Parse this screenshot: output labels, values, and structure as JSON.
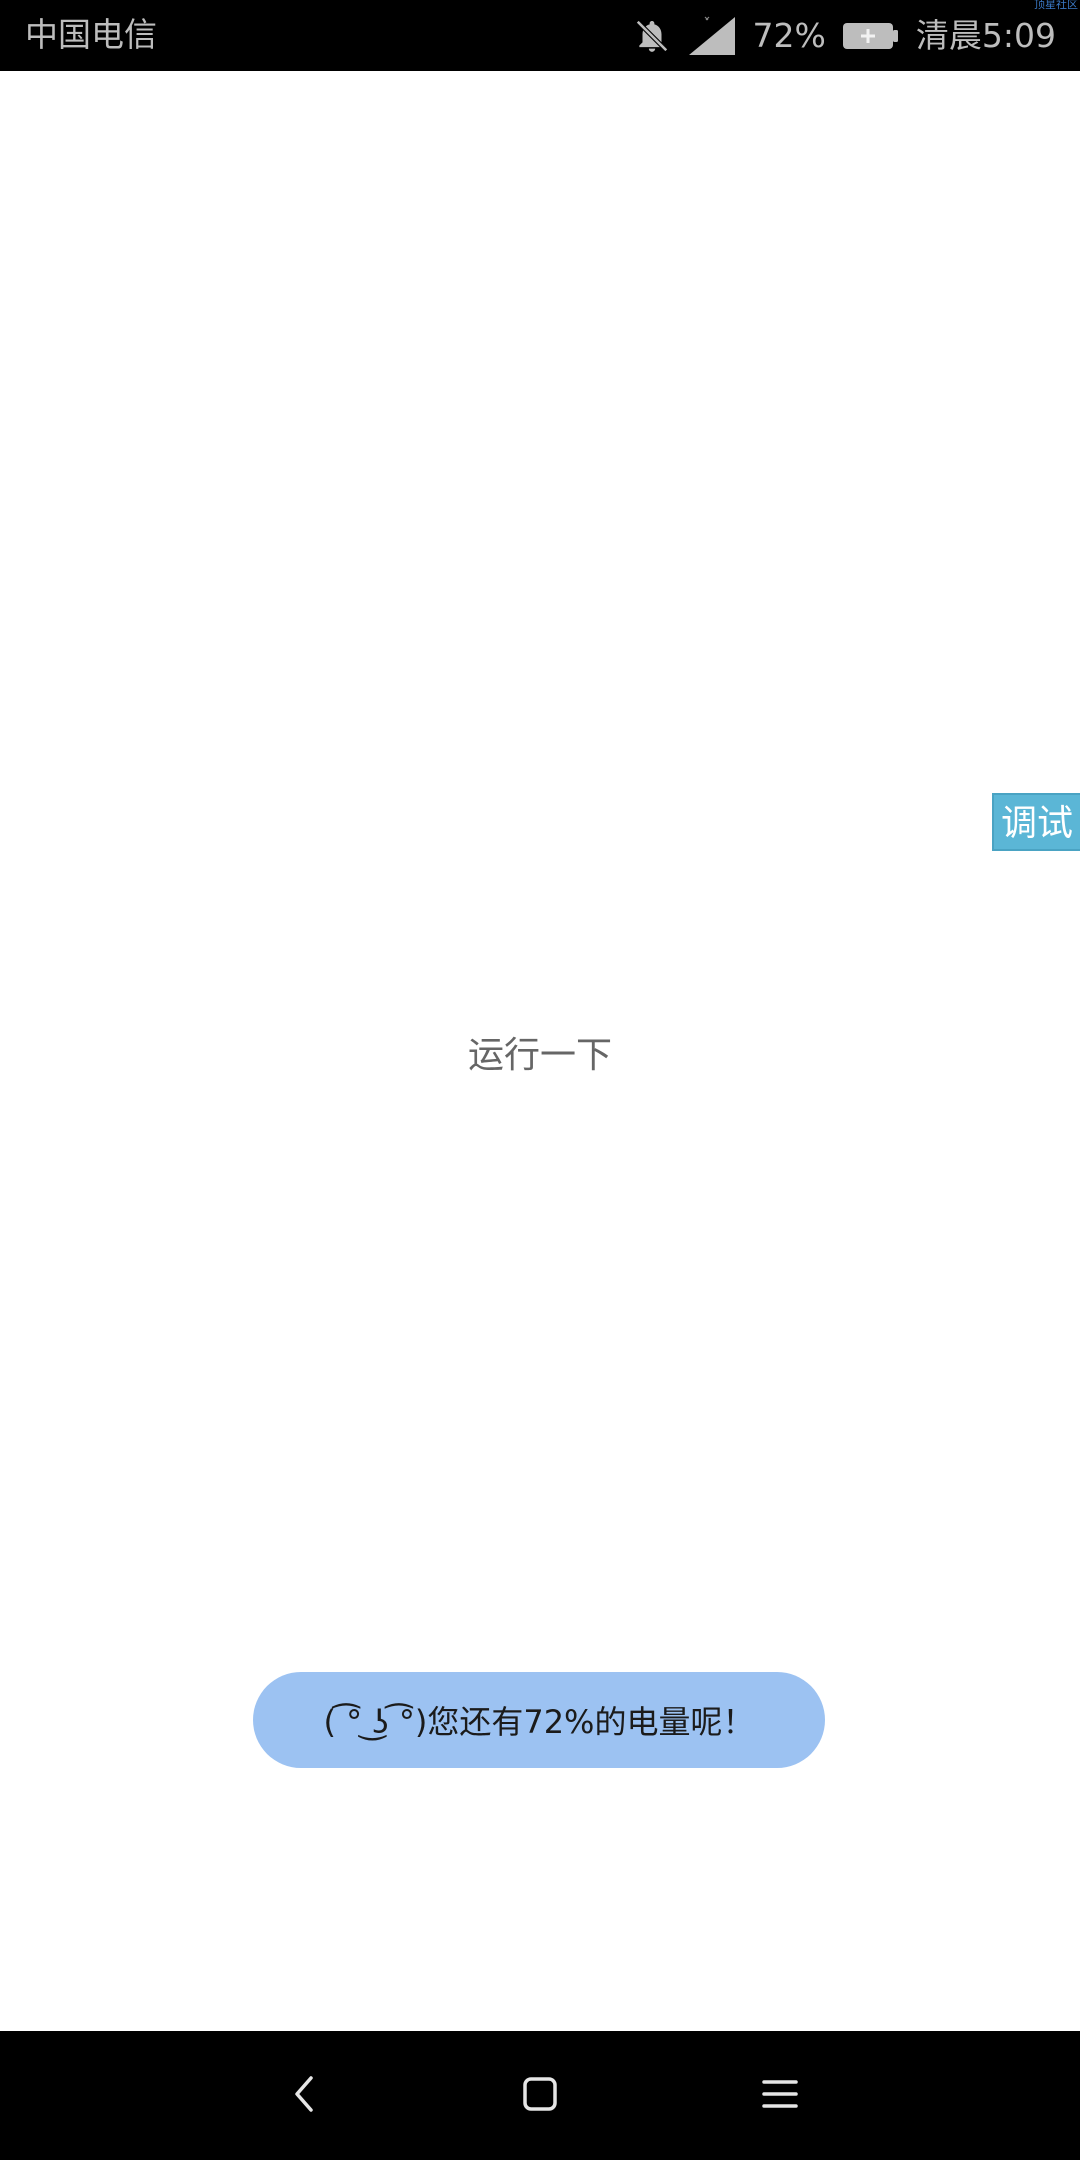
{
  "status_bar": {
    "carrier": "中国电信",
    "battery_percent": "72%",
    "battery_level": 0.72,
    "time": "清晨5:09",
    "watermark": "顶星社区",
    "icons": [
      "bell-off-icon",
      "signal-icon",
      "battery-charging-icon"
    ]
  },
  "main": {
    "debug_tab_label": "调试",
    "run_label": "运行一下"
  },
  "toast": {
    "text": "( ͡° ͜ʖ ͡°)您还有72%的电量呢！"
  },
  "nav_bar": {
    "icons": [
      "back-icon",
      "home-icon",
      "menu-icon"
    ]
  },
  "colors": {
    "status_bar_bg": "#000000",
    "debug_tab_bg": "#5bb6d6",
    "toast_bg": "#9cc2f2",
    "nav_bar_bg": "#000000"
  }
}
